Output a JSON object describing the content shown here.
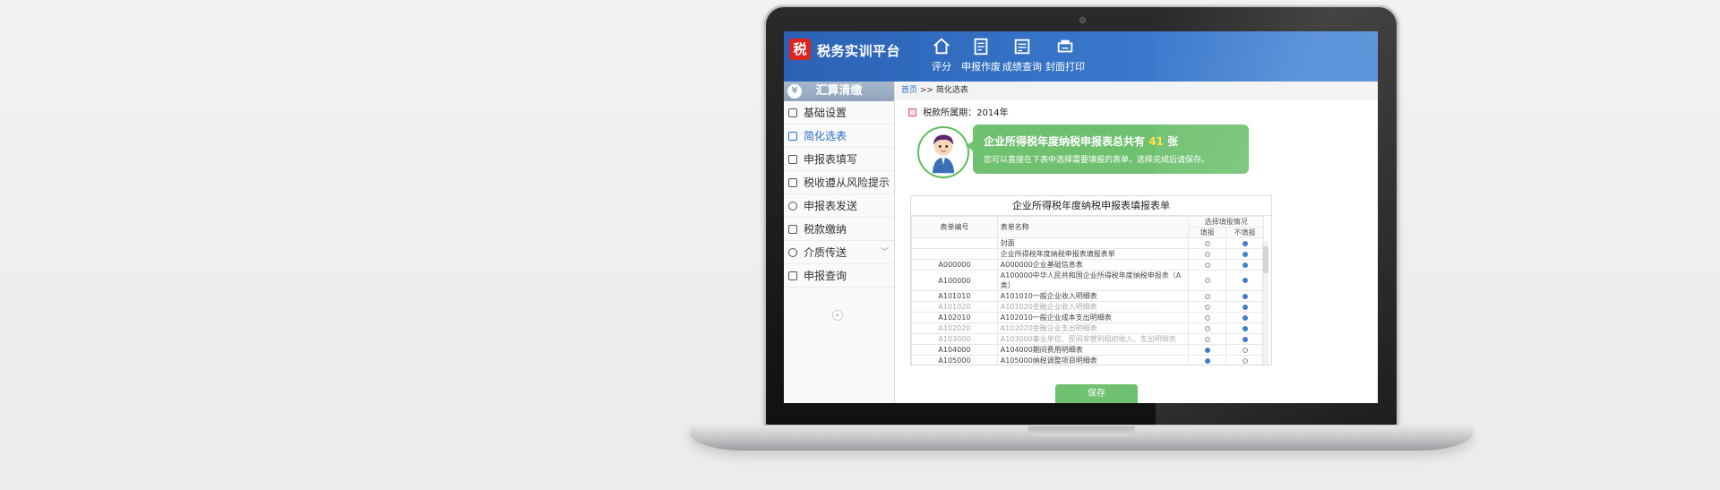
{
  "app": {
    "logo_char": "税",
    "title": "税务实训平台"
  },
  "nav": [
    {
      "label": "评分",
      "icon": "home-icon"
    },
    {
      "label": "申报作废",
      "icon": "document-icon"
    },
    {
      "label": "成绩查询",
      "icon": "report-icon"
    },
    {
      "label": "封面打印",
      "icon": "print-icon"
    }
  ],
  "sidebar": {
    "title": "汇算清缴",
    "items": [
      {
        "label": "基础设置",
        "icon": "lock-icon"
      },
      {
        "label": "简化选表",
        "icon": "select-icon",
        "active": true
      },
      {
        "label": "申报表填写",
        "icon": "edit-icon"
      },
      {
        "label": "税收遵从风险提示",
        "icon": "alert-icon"
      },
      {
        "label": "申报表发送",
        "icon": "clock-icon"
      },
      {
        "label": "税款缴纳",
        "icon": "wallet-icon"
      },
      {
        "label": "介质传送",
        "icon": "search-icon",
        "expandable": true
      },
      {
        "label": "申报查询",
        "icon": "query-icon"
      }
    ],
    "collapse_label": "«"
  },
  "breadcrumb": {
    "home": "首页",
    "separator": ">>",
    "current": "简化选表"
  },
  "period": {
    "label": "税款所属期：2014年"
  },
  "bubble": {
    "title_prefix": "企业所得税年度纳税申报表总共有",
    "count": "41",
    "title_suffix": "张",
    "subtitle": "您可以直接在下表中选择需要填报的表单，选择完成后请保存。"
  },
  "report": {
    "title": "企业所得税年度纳税申报表填报表单",
    "headers": {
      "code": "表单编号",
      "name": "表单名称",
      "choice": "选择填报情况",
      "fill": "填报",
      "nofill": "不填报"
    },
    "rows": [
      {
        "code": "",
        "name": "封面",
        "fill": false,
        "muted": false
      },
      {
        "code": "",
        "name": "企业所得税年度纳税申报表填报表单",
        "fill": false,
        "muted": false
      },
      {
        "code": "A000000",
        "name": "A000000企业基础信息表",
        "fill": false,
        "muted": false
      },
      {
        "code": "A100000",
        "name": "A100000中华人民共和国企业所得税年度纳税申报表（A类）",
        "fill": false,
        "muted": false
      },
      {
        "code": "A101010",
        "name": "A101010一般企业收入明细表",
        "fill": false,
        "muted": false
      },
      {
        "code": "A101020",
        "name": "A101020金融企业收入明细表",
        "fill": false,
        "muted": true
      },
      {
        "code": "A102010",
        "name": "A102010一般企业成本支出明细表",
        "fill": false,
        "muted": false
      },
      {
        "code": "A102020",
        "name": "A102020金融企业支出明细表",
        "fill": false,
        "muted": true
      },
      {
        "code": "A103000",
        "name": "A103000事业单位、民间非营利组织收入、支出明细表",
        "fill": false,
        "muted": true
      },
      {
        "code": "A104000",
        "name": "A104000期间费用明细表",
        "fill": true,
        "muted": false
      },
      {
        "code": "A105000",
        "name": "A105000纳税调整项目明细表",
        "fill": true,
        "muted": false
      }
    ]
  },
  "save_button": {
    "label": "保存"
  },
  "colors": {
    "header_blue": "#2b62b5",
    "accent_green": "#6fc170",
    "count_yellow": "#ffe24a"
  }
}
